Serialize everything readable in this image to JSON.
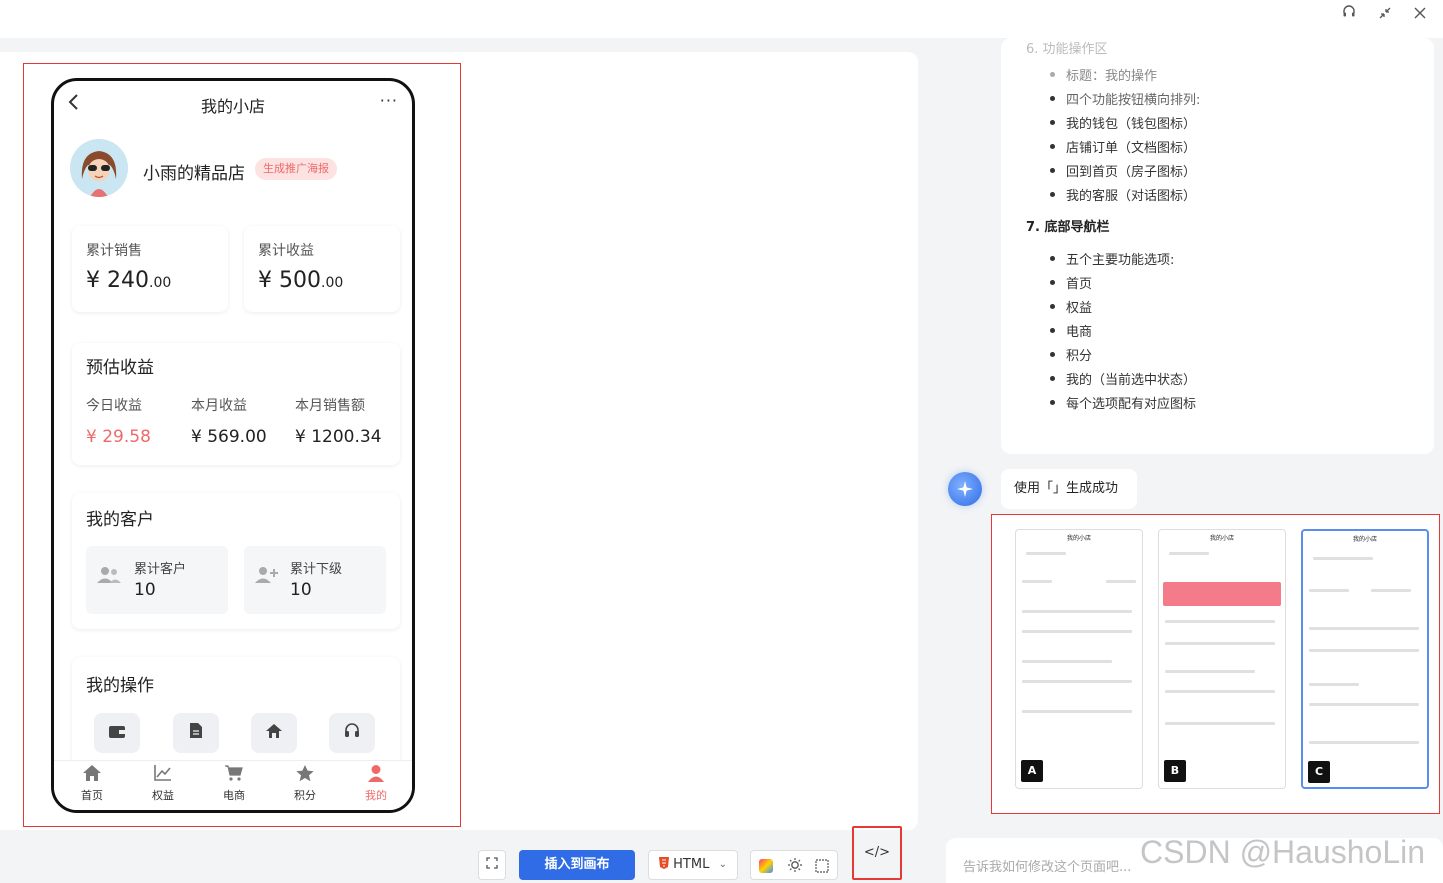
{
  "topbar": {
    "headset_icon": "headset-icon",
    "shrink_icon": "shrink-icon",
    "close_icon": "close-icon"
  },
  "phone": {
    "title": "我的小店",
    "more": "···",
    "back": "‹",
    "shop_name": "小雨的精品店",
    "badge": "生成推广海报",
    "stats": [
      {
        "label": "累计销售",
        "prefix": "¥ ",
        "int": "240",
        "dec": ".00"
      },
      {
        "label": "累计收益",
        "prefix": "¥ ",
        "int": "500",
        "dec": ".00"
      }
    ],
    "estimate": {
      "title": "预估收益",
      "items": [
        {
          "label": "今日收益",
          "value": "¥ 29.58"
        },
        {
          "label": "本月收益",
          "value": "¥ 569.00"
        },
        {
          "label": "本月销售额",
          "value": "¥ 1200.34"
        }
      ]
    },
    "customers": {
      "title": "我的客户",
      "items": [
        {
          "label": "累计客户",
          "value": "10"
        },
        {
          "label": "累计下级",
          "value": "10"
        }
      ]
    },
    "operations": {
      "title": "我的操作"
    },
    "tabs": [
      {
        "label": "首页",
        "icon": "home-icon"
      },
      {
        "label": "权益",
        "icon": "chart-icon"
      },
      {
        "label": "电商",
        "icon": "cart-icon"
      },
      {
        "label": "积分",
        "icon": "star-icon"
      },
      {
        "label": "我的",
        "icon": "user-icon"
      }
    ]
  },
  "toolbar": {
    "insert": "插入到画布",
    "format": "HTML",
    "code": "</>"
  },
  "chat": {
    "faded_top": "6. 功能操作区",
    "list1": [
      "标题：我的操作",
      "四个功能按钮横向排列:",
      "我的钱包（钱包图标）",
      "店铺订单（文档图标）",
      "回到首页（房子图标）",
      "我的客服（对话图标）"
    ],
    "heading": "7. 底部导航栏",
    "list2": [
      "五个主要功能选项:",
      "首页",
      "权益",
      "电商",
      "积分",
      "我的（当前选中状态）",
      "每个选项配有对应图标"
    ],
    "bot_msg": "使用「」生成成功",
    "input_placeholder": "告诉我如何修改这个页面吧...",
    "watermark": "CSDN @HaushoLin"
  },
  "thumbnails": [
    {
      "title": "我的小店",
      "letter": "A"
    },
    {
      "title": "我的小店",
      "letter": "B"
    },
    {
      "title": "我的小店",
      "letter": "C"
    }
  ]
}
